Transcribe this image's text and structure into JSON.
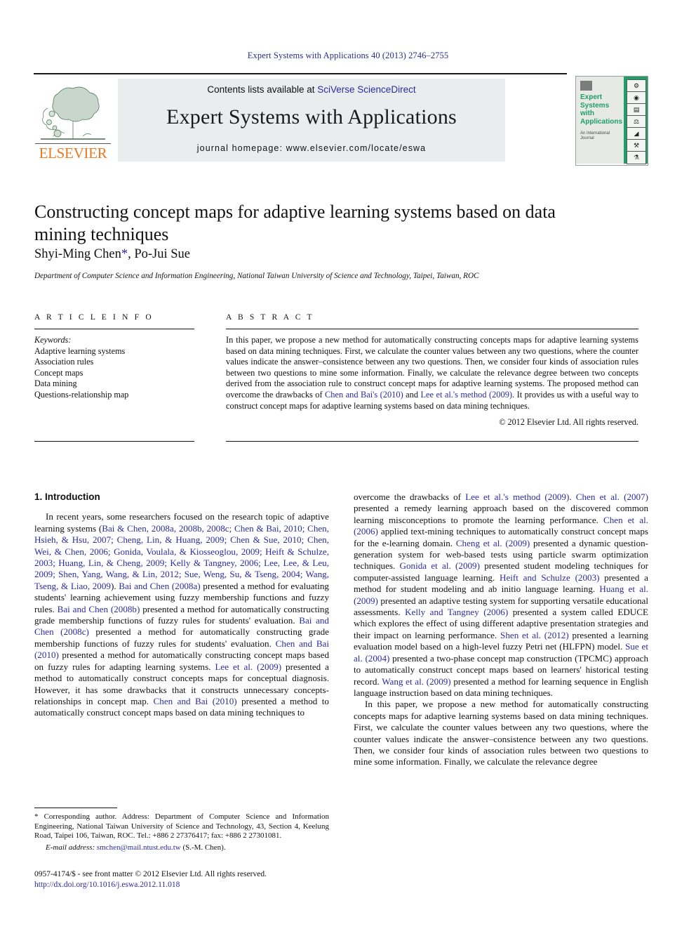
{
  "running_head": "Expert Systems with Applications 40 (2013) 2746–2755",
  "masthead": {
    "publisher_word": "ELSEVIER",
    "publisher_color": "#e87a22",
    "contents_prefix": "Contents lists available at ",
    "contents_link": "SciVerse ScienceDirect",
    "journal_title": "Expert Systems with Applications",
    "homepage_label": "journal homepage: www.elsevier.com/locate/eswa",
    "link_color": "#2b2b9f",
    "band_color": "#e9edee"
  },
  "cover": {
    "title": "Expert Systems with Applications",
    "subtitle": "An International Journal",
    "accent_color": "#1f9e67",
    "icons": [
      "⚙",
      "◔",
      "▐█▂",
      "⚖",
      "◢",
      "⚒",
      "⚗",
      "⚲"
    ]
  },
  "article": {
    "title": "Constructing concept maps for adaptive learning systems based on data mining techniques",
    "authors": "Shyi-Ming Chen",
    "author_star": "*",
    "authors_rest": ", Po-Jui Sue",
    "affiliation": "Department of Computer Science and Information Engineering, National Taiwan University of Science and Technology, Taipei, Taiwan, ROC"
  },
  "article_info": {
    "heading": "A R T I C L E   I N F O",
    "keywords_label": "Keywords:",
    "keywords": [
      "Adaptive learning systems",
      "Association rules",
      "Concept maps",
      "Data mining",
      "Questions-relationship map"
    ]
  },
  "abstract": {
    "heading": "A B S T R A C T",
    "part1": "In this paper, we propose a new method for automatically constructing concepts maps for adaptive learning systems based on data mining techniques. First, we calculate the counter values between any two questions, where the counter values indicate the answer–consistence between any two questions. Then, we consider four kinds of association rules between two questions to mine some information. Finally, we calculate the relevance degree between two concepts derived from the association rule to construct concept maps for adaptive learning systems. The proposed method can overcome the drawbacks of ",
    "link1": "Chen and Bai's (2010)",
    "mid1": " and ",
    "link2": "Lee et al.'s method (2009)",
    "part2": ". It provides us with a useful way to construct concept maps for adaptive learning systems based on data mining techniques.",
    "copyright": "© 2012 Elsevier Ltd. All rights reserved."
  },
  "body": {
    "section_title": "1. Introduction",
    "left": {
      "p1_a": "In recent years, some researchers focused on the research topic of adaptive learning systems (",
      "p1_refs": "Bai & Chen, 2008a, 2008b, 2008c; Chen & Bai, 2010; Chen, Hsieh, & Hsu, 2007; Cheng, Lin, & Huang, 2009; Chen & Sue, 2010; Chen, Wei, & Chen, 2006; Gonida, Voulala, & Kiosseoglou, 2009; Heift & Schulze, 2003; Huang, Lin, & Cheng, 2009; Kelly & Tangney, 2006; Lee, Lee, & Leu, 2009; Shen, Yang, Wang, & Lin, 2012; Sue, Weng, Su, & Tseng, 2004; Wang, Tseng, & Liao, 2009",
      "p1_b": "). ",
      "r1": "Bai and Chen (2008a)",
      "t1": " presented a method for evaluating students' learning achievement using fuzzy membership functions and fuzzy rules. ",
      "r2": "Bai and Chen (2008b)",
      "t2": " presented a method for automatically constructing grade membership functions of fuzzy rules for students' evaluation. ",
      "r3": "Bai and Chen (2008c)",
      "t3": " presented a method for automatically constructing grade membership functions of fuzzy rules for students' evaluation. ",
      "r4": "Chen and Bai (2010)",
      "t4": " presented a method for automatically constructing concept maps based on fuzzy rules for adapting learning systems. ",
      "r5": "Lee et al. (2009)",
      "t5": " presented a method to automatically construct concepts maps for conceptual diagnosis. However, it has some drawbacks that it constructs unnecessary concepts-relationships in concept map. ",
      "r6": "Chen and Bai (2010)",
      "t6": " presented a method to automatically construct concept maps based on data mining techniques to"
    },
    "right": {
      "t0": "overcome the drawbacks of ",
      "r0": "Lee et al.'s method (2009)",
      "t0b": ". ",
      "r1": "Chen et al. (2007)",
      "t1": " presented a remedy learning approach based on the discovered common learning misconceptions to promote the learning performance. ",
      "r2": "Chen et al. (2006)",
      "t2": " applied text-mining techniques to automatically construct concept maps for the e-learning domain. ",
      "r3": "Cheng et al. (2009)",
      "t3": " presented a dynamic question-generation system for web-based tests using particle swarm optimization techniques. ",
      "r4": "Gonida et al. (2009)",
      "t4": " presented student modeling techniques for computer-assisted language learning. ",
      "r5": "Heift and Schulze (2003)",
      "t5": " presented a method for student modeling and ab initio language learning. ",
      "r6": "Huang et al. (2009)",
      "t6": " presented an adaptive testing system for supporting versatile educational assessments. ",
      "r7": "Kelly and Tangney (2006)",
      "t7": " presented a system called EDUCE which explores the effect of using different adaptive presentation strategies and their impact on learning performance. ",
      "r8": "Shen et al. (2012)",
      "t8": " presented a learning evaluation model based on a high-level fuzzy Petri net (HLFPN) model. ",
      "r9": "Sue et al. (2004)",
      "t9": " presented a two-phase concept map construction (TPCMC) approach to automatically construct concept maps based on learners' historical testing record. ",
      "r10": "Wang et al. (2009)",
      "t10": " presented a method for learning sequence in English language instruction based on data mining techniques.",
      "p2": "In this paper, we propose a new method for automatically constructing concepts maps for adaptive learning systems based on data mining techniques. First, we calculate the counter values between any two questions, where the counter values indicate the answer–consistence between any two questions. Then, we consider four kinds of association rules between two questions to mine some information. Finally, we calculate the relevance degree"
    }
  },
  "footnote": {
    "corresponding": "* Corresponding author. Address: Department of Computer Science and Information Engineering, National Taiwan University of Science and Technology, 43, Section 4, Keelung Road, Taipei 106, Taiwan, ROC. Tel.: +886 2 27376417; fax: +886 2 27301081.",
    "email_label": "E-mail address:",
    "email": "smchen@mail.ntust.edu.tw",
    "email_suffix": " (S.-M. Chen)."
  },
  "colophon": {
    "issn_line": "0957-4174/$ - see front matter © 2012 Elsevier Ltd. All rights reserved.",
    "doi": "http://dx.doi.org/10.1016/j.eswa.2012.11.018"
  }
}
